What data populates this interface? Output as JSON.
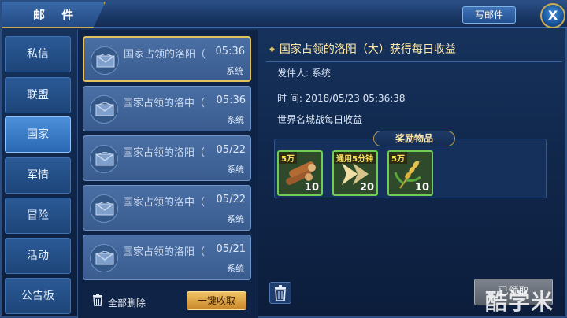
{
  "header": {
    "title": "邮 件",
    "write_mail": "写邮件",
    "close": "X"
  },
  "sidebar": {
    "tabs": [
      {
        "label": "私信"
      },
      {
        "label": "联盟"
      },
      {
        "label": "国家"
      },
      {
        "label": "军情"
      },
      {
        "label": "冒险"
      },
      {
        "label": "活动"
      },
      {
        "label": "公告板"
      }
    ],
    "active_index": 2
  },
  "mail_list": {
    "items": [
      {
        "title": "国家占领的洛阳（",
        "time": "05:36",
        "sender": "系统"
      },
      {
        "title": "国家占领的洛中（",
        "time": "05:36",
        "sender": "系统"
      },
      {
        "title": "国家占领的洛阳（",
        "time": "05/22",
        "sender": "系统"
      },
      {
        "title": "国家占领的洛中（",
        "time": "05/22",
        "sender": "系统"
      },
      {
        "title": "国家占领的洛阳（",
        "time": "05/21",
        "sender": "系统"
      }
    ],
    "selected_index": 0,
    "delete_all": "全部删除",
    "collect_all": "一键收取"
  },
  "detail": {
    "title": "国家占领的洛阳（大）获得每日收益",
    "sender_line": "发件人: 系统",
    "time_line": "时   间: 2018/05/23  05:36:38",
    "body": "世界名城战每日收益",
    "reward_header": "奖励物品",
    "rewards": [
      {
        "tag": "5万",
        "count": "10",
        "icon": "wood-logs-icon"
      },
      {
        "tag": "通用5分钟",
        "count": "20",
        "icon": "speedup-arrow-icon"
      },
      {
        "tag": "5万",
        "count": "10",
        "icon": "wheat-icon"
      }
    ],
    "claimed_label": "已领取"
  },
  "watermark": "酷学米"
}
